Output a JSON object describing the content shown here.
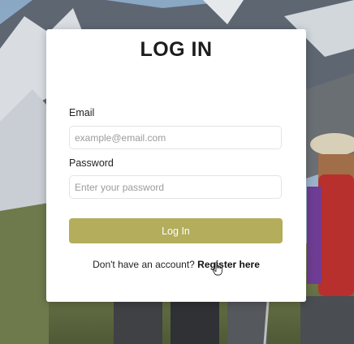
{
  "form": {
    "title": "LOG IN",
    "email_label": "Email",
    "email_placeholder": "example@email.com",
    "password_label": "Password",
    "password_placeholder": "Enter your password",
    "login_button": "Log In",
    "no_account_text": "Don't have an account?",
    "register_link": "Register here"
  },
  "colors": {
    "button": "#b3ad5c",
    "card": "#ffffff"
  }
}
